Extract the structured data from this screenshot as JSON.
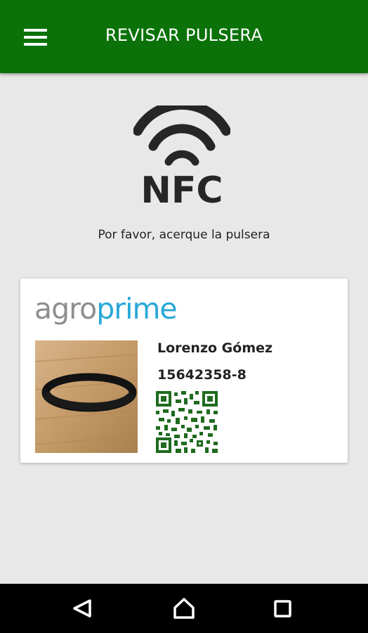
{
  "appbar": {
    "title": "REVISAR PULSERA",
    "menu_icon": "hamburger-menu-icon",
    "background": "#0b7209"
  },
  "nfc": {
    "icon": "nfc-icon",
    "label": "NFC"
  },
  "prompt": "Por favor, acerque la pulsera",
  "card": {
    "brand_part1": "agro",
    "brand_part2": "prime",
    "brand_color_1": "#8e8e8e",
    "brand_color_2": "#29a8d8",
    "photo": "wristband-photo",
    "name": "Lorenzo Gómez",
    "id": "15642358-8",
    "qr_icon": "qr-code",
    "qr_color": "#1f6b1f"
  },
  "navbar": {
    "back_icon": "back-icon",
    "home_icon": "home-icon",
    "recents_icon": "recents-icon"
  }
}
